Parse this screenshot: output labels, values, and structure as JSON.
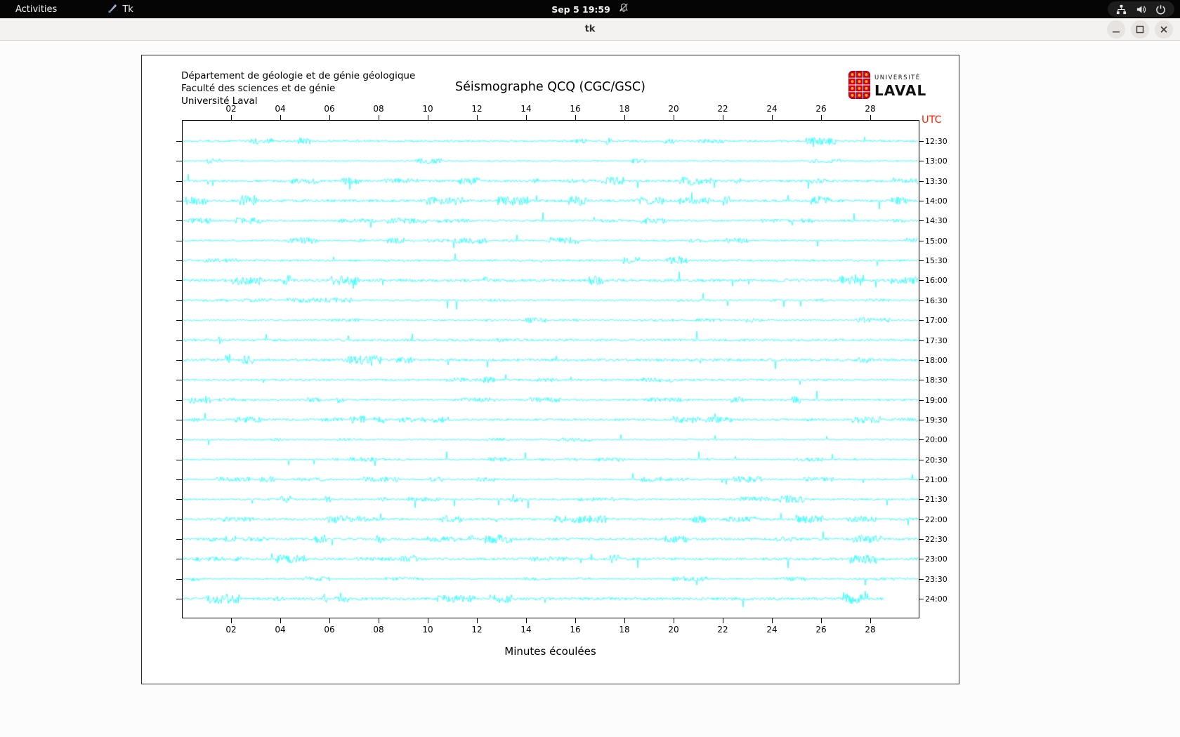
{
  "top_bar": {
    "activities_label": "Activities",
    "app_menu_label": "Tk",
    "clock": "Sep 5 19:59"
  },
  "window": {
    "title": "tk"
  },
  "figure": {
    "institution_lines": [
      "Département de géologie et de génie géologique",
      "Faculté des sciences et de génie",
      "Université Laval"
    ],
    "title": "Séismographe QCQ (CGC/GSC)",
    "logo_top": "UNIVERSITÉ",
    "logo_bottom": "LAVAL",
    "logo_red": "#d6001c",
    "utc_label": "UTC",
    "utc_color": "#ff2400",
    "xlabel": "Minutes écoulées"
  },
  "chart_data": {
    "type": "line",
    "title": "Séismographe QCQ (CGC/GSC)",
    "xlabel": "Minutes écoulées",
    "x_range_minutes": [
      0,
      30
    ],
    "x_tick_minutes": [
      2,
      4,
      6,
      8,
      10,
      12,
      14,
      16,
      18,
      20,
      22,
      24,
      26,
      28
    ],
    "x_tick_labels": [
      "02",
      "04",
      "06",
      "08",
      "10",
      "12",
      "14",
      "16",
      "18",
      "20",
      "22",
      "24",
      "26",
      "28"
    ],
    "row_labels": [
      "12:30",
      "13:00",
      "13:30",
      "14:00",
      "14:30",
      "15:00",
      "15:30",
      "16:00",
      "16:30",
      "17:00",
      "17:30",
      "18:00",
      "18:30",
      "19:00",
      "19:30",
      "20:00",
      "20:30",
      "21:00",
      "21:30",
      "22:00",
      "22:30",
      "23:00",
      "23:30",
      "24:00"
    ],
    "n_traces": 24,
    "last_trace_end_minute": 28.6,
    "trace_color": "#00ffff"
  }
}
